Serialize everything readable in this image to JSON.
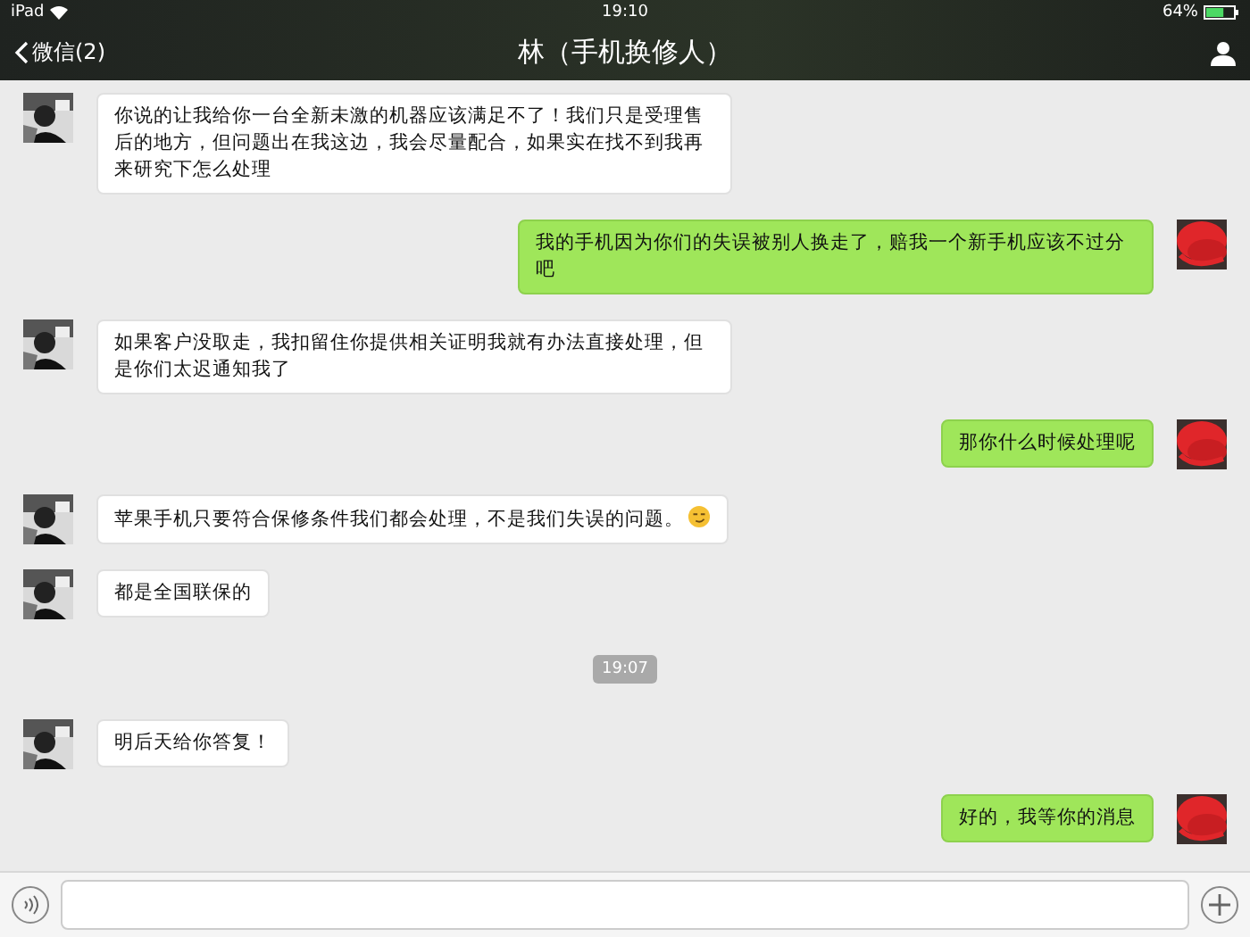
{
  "status_bar": {
    "device": "iPad",
    "time": "19:10",
    "battery": "64%"
  },
  "nav_bar": {
    "back": "微信(2)",
    "title": "林（手机换修人）"
  },
  "messages": [
    {
      "kind": "received",
      "text": "你说的让我给你一台全新未激的机器应该满足不了！我们只是受理售后的地方，但问题出在我这边，我会尽量配合，如果实在找不到我再来研究下怎么处理"
    },
    {
      "kind": "sent",
      "text": "我的手机因为你们的失误被别人换走了，赔我一个新手机应该不过分吧"
    },
    {
      "kind": "received",
      "text": "如果客户没取走，我扣留住你提供相关证明我就有办法直接处理，但是你们太迟通知我了"
    },
    {
      "kind": "sent",
      "text": "那你什么时候处理呢"
    },
    {
      "kind": "received",
      "text": "苹果手机只要符合保修条件我们都会处理，不是我们失误的问题。",
      "trailing_emoji": true
    },
    {
      "kind": "received",
      "text": "都是全国联保的"
    },
    {
      "kind": "time",
      "text": "19:07"
    },
    {
      "kind": "received",
      "text": "明后天给你答复！"
    },
    {
      "kind": "sent",
      "text": "好的，我等你的消息"
    }
  ]
}
